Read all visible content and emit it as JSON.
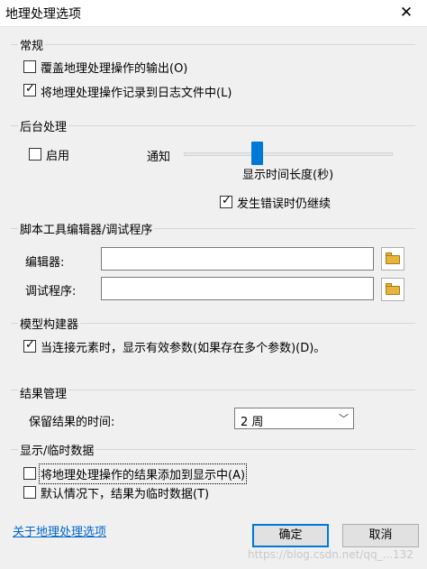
{
  "window": {
    "title": "地理处理选项",
    "close_glyph": "✕"
  },
  "general": {
    "label": "常规",
    "overwrite": {
      "label": "覆盖地理处理操作的输出(O)",
      "checked": false
    },
    "log": {
      "label": "将地理处理操作记录到日志文件中(L)",
      "checked": true
    }
  },
  "background": {
    "label": "后台处理",
    "enable": {
      "label": "启用",
      "checked": false
    },
    "notify_label": "通知",
    "duration_label": "显示时间长度(秒)",
    "continue_on_error": {
      "label": "发生错误时仍继续",
      "checked": true
    }
  },
  "script": {
    "label": "脚本工具编辑器/调试程序",
    "editor_label": "编辑器:",
    "editor_value": "",
    "debugger_label": "调试程序:",
    "debugger_value": ""
  },
  "modelbuilder": {
    "label": "模型构建器",
    "show_params": {
      "label": "当连接元素时，显示有效参数(如果存在多个参数)(D)。",
      "checked": true
    }
  },
  "results": {
    "label": "结果管理",
    "keep_label": "保留结果的时间:",
    "keep_value": "2 周"
  },
  "display": {
    "label": "显示/临时数据",
    "add_results": {
      "label": "将地理处理操作的结果添加到显示中(A)",
      "checked": false
    },
    "temp_default": {
      "label": "默认情况下，结果为临时数据(T)",
      "checked": false
    }
  },
  "footer": {
    "about_link": "关于地理处理选项",
    "ok_label": "确定",
    "cancel_label": "取消"
  },
  "watermark": "https://blog.csdn.net/qq_...132",
  "colors": {
    "accent": "#0078d7",
    "link": "#0066cc",
    "folder": "#e8b53c"
  }
}
